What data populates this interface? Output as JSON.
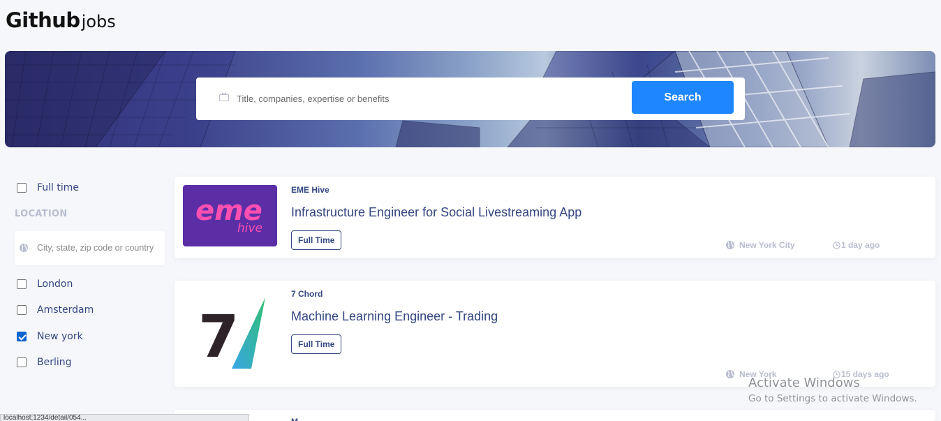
{
  "header": {
    "brand_bold": "Github",
    "brand_light": "jobs"
  },
  "search": {
    "placeholder": "Title, companies, expertise or benefits",
    "value": "",
    "button_label": "Search",
    "icon": "briefcase-icon"
  },
  "filters": {
    "full_time": {
      "label": "Full time",
      "checked": false
    },
    "location_title": "LOCATION",
    "location_input": {
      "placeholder": "City, state, zip code or country",
      "value": "",
      "icon": "globe-icon"
    },
    "locations": [
      {
        "label": "London",
        "checked": false
      },
      {
        "label": "Amsterdam",
        "checked": false
      },
      {
        "label": "New york",
        "checked": true
      },
      {
        "label": "Berling",
        "checked": false
      }
    ]
  },
  "jobs": [
    {
      "company": "EME Hive",
      "title": "Infrastructure Engineer for Social Livestreaming App",
      "type": "Full Time",
      "location": "New York City",
      "posted": "1 day ago",
      "logo": {
        "text_main": "eme",
        "text_sub": "hive",
        "bg": "#5b2ea6",
        "fg": "#ff4fb0"
      }
    },
    {
      "company": "7 Chord",
      "title": "Machine Learning Engineer - Trading",
      "type": "Full Time",
      "location": "New York",
      "posted": "15 days ago",
      "logo": {
        "text_main": "7",
        "fg": "#2d2328",
        "accent_from": "#3aa6e6",
        "accent_to": "#2fbf71"
      }
    },
    {
      "company": "M"
    }
  ],
  "colors": {
    "accent": "#1e86ff",
    "text": "#334680",
    "muted": "#b9bdcf",
    "background": "#f6f7fb"
  },
  "os_overlay": {
    "line1": "Activate Windows",
    "line2": "Go to Settings to activate Windows."
  },
  "status_bar": {
    "text": "localhost:1234/detail/054..."
  }
}
